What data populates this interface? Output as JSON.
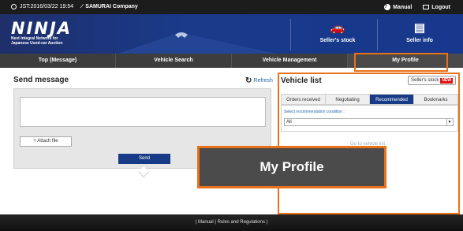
{
  "topbar": {
    "datetime": "JST:2016/03/22 19:54",
    "company": "SAMURAI Company",
    "manual": "Manual",
    "logout": "Logout"
  },
  "header": {
    "logo": "NINJA",
    "tagline_1": "Next Integral Network for",
    "tagline_2": "Japanese Used-car Auction",
    "sellers_stock": "Seller's stock",
    "seller_info": "Seller info"
  },
  "nav": {
    "items": [
      "Top (Message)",
      "Vehicle Search",
      "Vehicle Management",
      "My Profile"
    ]
  },
  "send_message": {
    "title": "Send message",
    "refresh": "Refresh",
    "attach": "+ Attach file",
    "send": "Send",
    "message_value": ""
  },
  "vehicle_list": {
    "title": "Vehicle list",
    "sellers_stock_button": "Seller's stock",
    "new_badge": "NEW",
    "tabs": [
      "Orders received",
      "Negotiating",
      "Recommended",
      "Bookmarks"
    ],
    "active_tab": "Recommended",
    "condition_label": "Select recommendation condition :",
    "condition_value": "All",
    "dim_link": "Go to vehicle list"
  },
  "tooltip": {
    "text": "My Profile"
  },
  "footer": {
    "links": "| Manual | Rules and Regulations |"
  },
  "colors": {
    "accent": "#e8711a",
    "brand": "#173b86"
  }
}
